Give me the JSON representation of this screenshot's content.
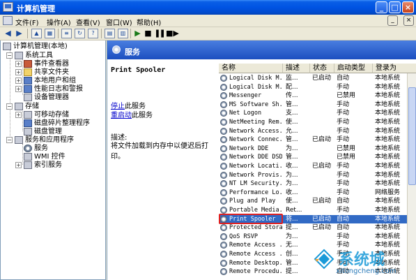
{
  "window": {
    "title": "计算机管理"
  },
  "menubar": {
    "items": [
      "文件(F)",
      "操作(A)",
      "查看(V)",
      "窗口(W)",
      "帮助(H)"
    ]
  },
  "tree": {
    "root": "计算机管理(本地)",
    "nodes": [
      {
        "label": "系统工具",
        "level": 1
      },
      {
        "label": "事件查看器",
        "level": 2
      },
      {
        "label": "共享文件夹",
        "level": 2
      },
      {
        "label": "本地用户和组",
        "level": 2
      },
      {
        "label": "性能日志和警报",
        "level": 2
      },
      {
        "label": "设备管理器",
        "level": 2
      },
      {
        "label": "存储",
        "level": 1
      },
      {
        "label": "可移动存储",
        "level": 2
      },
      {
        "label": "磁盘碎片整理程序",
        "level": 2
      },
      {
        "label": "磁盘管理",
        "level": 2
      },
      {
        "label": "服务和应用程序",
        "level": 1
      },
      {
        "label": "服务",
        "level": 2
      },
      {
        "label": "WMI 控件",
        "level": 2
      },
      {
        "label": "索引服务",
        "level": 2
      }
    ]
  },
  "services_header": {
    "title": "服务"
  },
  "description": {
    "service_name": "Print Spooler",
    "stop_link": "停止",
    "stop_rest": "此服务",
    "restart_link": "重启动",
    "restart_rest": "此服务",
    "desc_label": "描述:",
    "desc_text": "将文件加载到内存中以便迟后打印。"
  },
  "columns": [
    "名称",
    "描述",
    "状态",
    "启动类型",
    "登录为"
  ],
  "rows": [
    {
      "name": "Logical Disk M...",
      "desc": "监...",
      "status": "已启动",
      "start": "自动",
      "logon": "本地系统"
    },
    {
      "name": "Logical Disk M...",
      "desc": "配...",
      "status": "",
      "start": "手动",
      "logon": "本地系统"
    },
    {
      "name": "Messenger",
      "desc": "传...",
      "status": "",
      "start": "已禁用",
      "logon": "本地系统"
    },
    {
      "name": "MS Software Sh...",
      "desc": "管...",
      "status": "",
      "start": "手动",
      "logon": "本地系统"
    },
    {
      "name": "Net Logon",
      "desc": "支...",
      "status": "",
      "start": "手动",
      "logon": "本地系统"
    },
    {
      "name": "NetMeeting Rem...",
      "desc": "使...",
      "status": "",
      "start": "手动",
      "logon": "本地系统"
    },
    {
      "name": "Network Access...",
      "desc": "允...",
      "status": "",
      "start": "手动",
      "logon": "本地系统"
    },
    {
      "name": "Network Connec...",
      "desc": "管...",
      "status": "已启动",
      "start": "手动",
      "logon": "本地系统"
    },
    {
      "name": "Network DDE",
      "desc": "为...",
      "status": "",
      "start": "已禁用",
      "logon": "本地系统"
    },
    {
      "name": "Network DDE DSDM",
      "desc": "管...",
      "status": "",
      "start": "已禁用",
      "logon": "本地系统"
    },
    {
      "name": "Network Locati...",
      "desc": "收...",
      "status": "已启动",
      "start": "手动",
      "logon": "本地系统"
    },
    {
      "name": "Network Provis...",
      "desc": "为...",
      "status": "",
      "start": "手动",
      "logon": "本地系统"
    },
    {
      "name": "NT LM Security...",
      "desc": "为...",
      "status": "",
      "start": "手动",
      "logon": "本地系统"
    },
    {
      "name": "Performance Lo...",
      "desc": "收...",
      "status": "",
      "start": "手动",
      "logon": "网络服务"
    },
    {
      "name": "Plug and Play",
      "desc": "使...",
      "status": "已启动",
      "start": "自动",
      "logon": "本地系统"
    },
    {
      "name": "Portable Media...",
      "desc": "Ret...",
      "status": "",
      "start": "手动",
      "logon": "本地系统"
    },
    {
      "name": "Print Spooler",
      "desc": "将...",
      "status": "已启动",
      "start": "自动",
      "logon": "本地系统",
      "selected": true
    },
    {
      "name": "Protected Storage",
      "desc": "提...",
      "status": "已启动",
      "start": "自动",
      "logon": "本地系统"
    },
    {
      "name": "QoS RSVP",
      "desc": "为...",
      "status": "",
      "start": "手动",
      "logon": "本地系统"
    },
    {
      "name": "Remote Access ...",
      "desc": "无...",
      "status": "",
      "start": "手动",
      "logon": "本地系统"
    },
    {
      "name": "Remote Access ...",
      "desc": "创...",
      "status": "",
      "start": "手动",
      "logon": "本地系统"
    },
    {
      "name": "Remote Desktop...",
      "desc": "管...",
      "status": "",
      "start": "手动",
      "logon": "本地系统"
    },
    {
      "name": "Remote Procedu...",
      "desc": "提...",
      "status": "",
      "start": "自动",
      "logon": "本地系统"
    }
  ],
  "watermark": {
    "text": "系统城",
    "url": "xitongcheng.com"
  }
}
